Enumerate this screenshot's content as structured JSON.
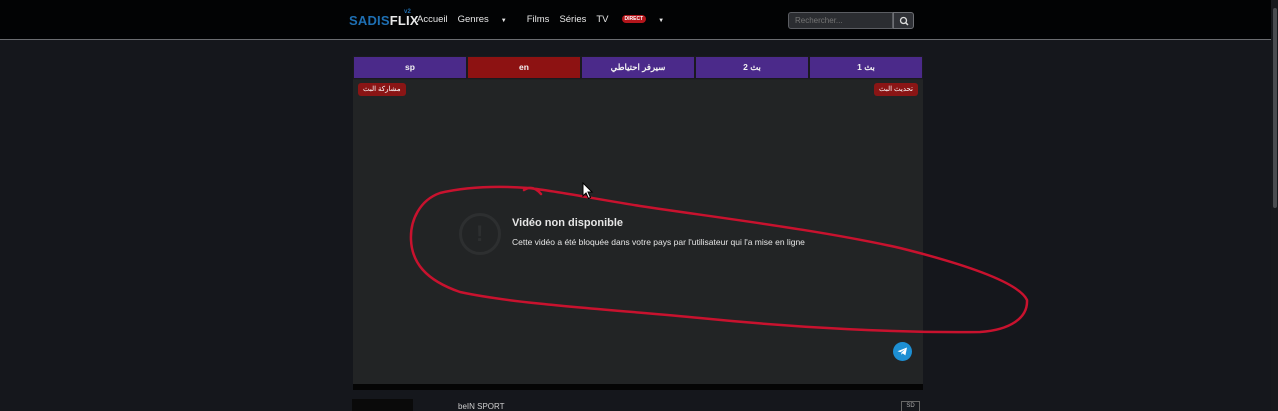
{
  "logo": {
    "part1": "SADIS",
    "part2": "FLIX",
    "sup": "v2"
  },
  "nav": {
    "items": [
      "Accueil",
      "Genres",
      "Films",
      "Séries",
      "TV"
    ],
    "direct_badge": "DIRECT"
  },
  "search": {
    "placeholder": "Rechercher..."
  },
  "player": {
    "tabs": [
      "sp",
      "en",
      "سيرفر احتياطي",
      "بث 2",
      "بث 1"
    ],
    "active_tab": "en",
    "share_label": "مشاركة البث",
    "refresh_label": "تحديث البث",
    "error_title": "Vidéo non disponible",
    "error_message": "Cette vidéo a été bloquée dans votre pays par l'utilisateur qui l'a mise en ligne"
  },
  "list": {
    "channel_name": "beIN SPORT",
    "quality_badge": "SD"
  },
  "colors": {
    "tab_bg": "#4b2a8a",
    "tab_active": "#8d1212",
    "scribble": "#c8122e",
    "accent_blue": "#1e6fb3"
  },
  "icons": [
    "search-icon",
    "telegram-icon",
    "error-icon",
    "mouse-cursor-icon"
  ]
}
